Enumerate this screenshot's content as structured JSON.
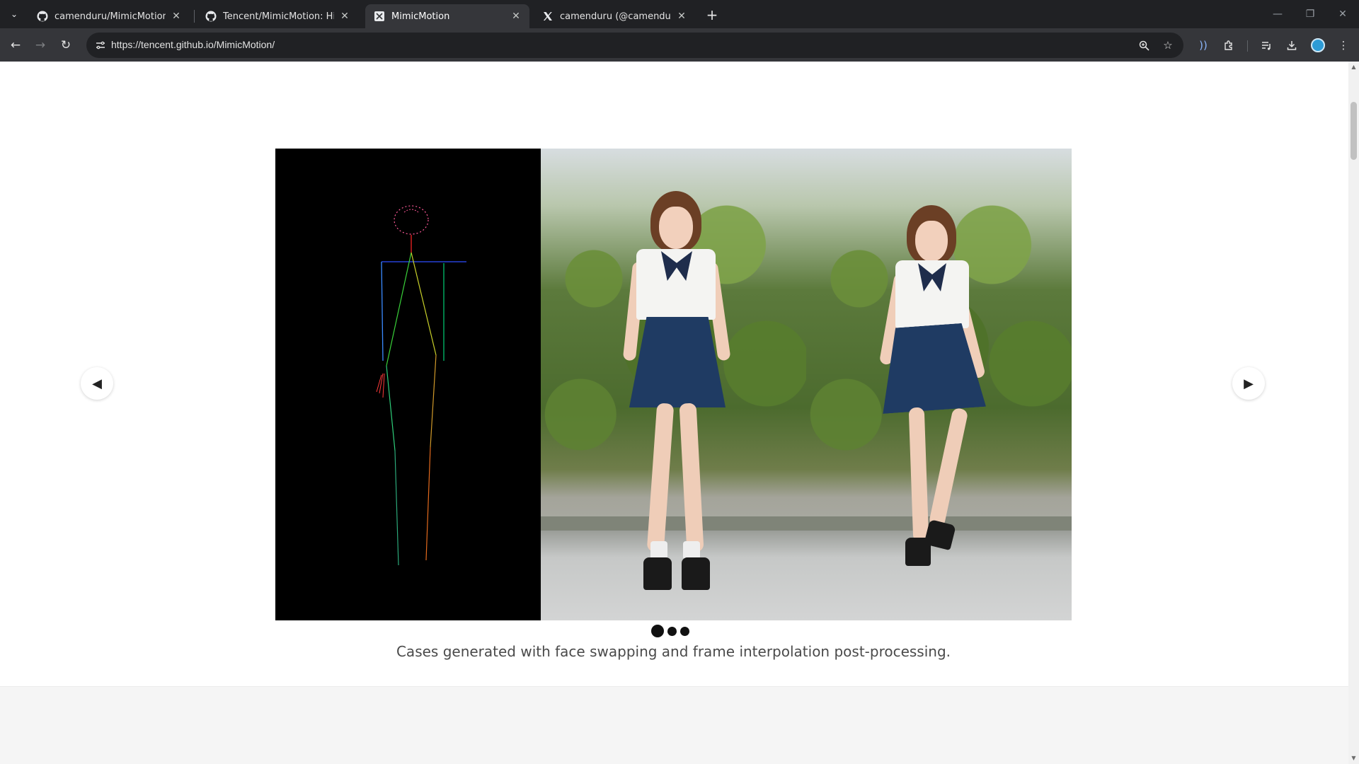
{
  "browser": {
    "tabs": [
      {
        "title": "camenduru/MimicMotion-jupyter",
        "icon": "github-icon",
        "active": false
      },
      {
        "title": "Tencent/MimicMotion: High-Quality",
        "icon": "github-icon",
        "active": false
      },
      {
        "title": "MimicMotion",
        "icon": "site-favicon",
        "active": true
      },
      {
        "title": "camenduru (@camenduru) / X",
        "icon": "x-icon",
        "active": false
      }
    ],
    "url": "https://tencent.github.io/MimicMotion/",
    "new_tab_label": "+",
    "close_glyph": "✕"
  },
  "carousel": {
    "panels": [
      {
        "kind": "pose-skeleton",
        "alt": "pose sequence"
      },
      {
        "kind": "reference-image",
        "alt": "reference image"
      },
      {
        "kind": "generated-video",
        "alt": "generated video frame"
      }
    ],
    "prev_glyph": "◀",
    "next_glyph": "▶",
    "dots": 3,
    "active_dot": 0,
    "caption": "Cases generated with face swapping and frame interpolation post-processing."
  },
  "colors": {
    "chrome_dark": "#202124",
    "toolbar": "#35363a",
    "page_bg": "#ffffff",
    "section_gray": "#f5f5f5",
    "caption_text": "#4a4a4a"
  }
}
